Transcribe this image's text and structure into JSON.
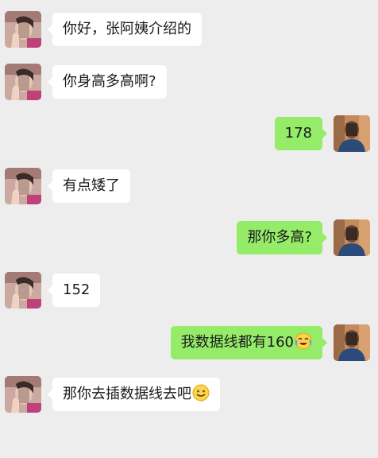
{
  "messages": [
    {
      "side": "left",
      "text": "你好，张阿姨介绍的"
    },
    {
      "side": "left",
      "text": "你身高多高啊?"
    },
    {
      "side": "right",
      "text": "178"
    },
    {
      "side": "left",
      "text": "有点矮了"
    },
    {
      "side": "right",
      "text": "那你多高?"
    },
    {
      "side": "left",
      "text": "152"
    },
    {
      "side": "right",
      "text": "我数据线都有160",
      "emoji": "laugh-cry-emoji"
    },
    {
      "side": "left",
      "text": "那你去插数据线去吧",
      "emoji": "smile-emoji"
    }
  ],
  "colors": {
    "background": "#ededed",
    "left_bubble": "#ffffff",
    "right_bubble": "#95ec69",
    "text": "#1a1a1a"
  }
}
